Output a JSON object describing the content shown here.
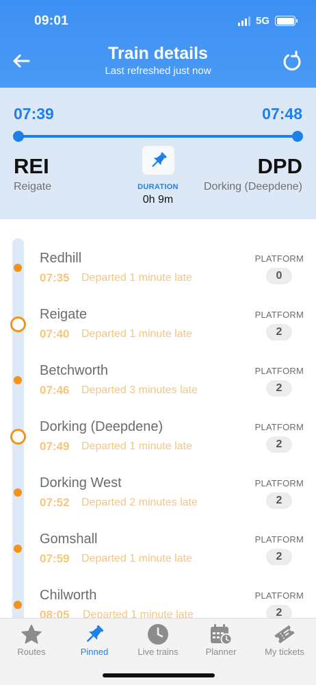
{
  "status_bar": {
    "time": "09:01",
    "network": "5G"
  },
  "header": {
    "title": "Train details",
    "subtitle": "Last refreshed just now",
    "back_icon": "arrow-left-icon",
    "refresh_icon": "refresh-icon"
  },
  "summary": {
    "departure_time": "07:39",
    "arrival_time": "07:48",
    "from_code": "REI",
    "from_name": "Reigate",
    "to_code": "DPD",
    "to_name": "Dorking (Deepdene)",
    "duration_label": "DURATION",
    "duration_value": "0h 9m",
    "pin_icon": "pin-icon"
  },
  "colors": {
    "accent": "#1e7fe6",
    "late": "#f39319",
    "late_text": "#f6c57e",
    "header_bg": "#3d8ff2",
    "summary_bg": "#dce8f6"
  },
  "stops": [
    {
      "name": "Redhill",
      "time": "07:35",
      "status": "Departed 1 minute late",
      "platform_label": "PLATFORM",
      "platform": "0",
      "highlight": false
    },
    {
      "name": "Reigate",
      "time": "07:40",
      "status": "Departed 1 minute late",
      "platform_label": "PLATFORM",
      "platform": "2",
      "highlight": true
    },
    {
      "name": "Betchworth",
      "time": "07:46",
      "status": "Departed 3 minutes late",
      "platform_label": "PLATFORM",
      "platform": "2",
      "highlight": false
    },
    {
      "name": "Dorking (Deepdene)",
      "time": "07:49",
      "status": "Departed 1 minute late",
      "platform_label": "PLATFORM",
      "platform": "2",
      "highlight": true
    },
    {
      "name": "Dorking West",
      "time": "07:52",
      "status": "Departed 2 minutes late",
      "platform_label": "PLATFORM",
      "platform": "2",
      "highlight": false
    },
    {
      "name": "Gomshall",
      "time": "07:59",
      "status": "Departed 1 minute late",
      "platform_label": "PLATFORM",
      "platform": "2",
      "highlight": false
    },
    {
      "name": "Chilworth",
      "time": "08:05",
      "status": "Departed 1 minute late",
      "platform_label": "PLATFORM",
      "platform": "2",
      "highlight": false
    }
  ],
  "tabs": [
    {
      "label": "Routes",
      "icon": "star-icon",
      "active": false
    },
    {
      "label": "Pinned",
      "icon": "pin-icon",
      "active": true
    },
    {
      "label": "Live trains",
      "icon": "clock-icon",
      "active": false
    },
    {
      "label": "Planner",
      "icon": "calendar-icon",
      "active": false
    },
    {
      "label": "My tickets",
      "icon": "ticket-icon",
      "active": false
    }
  ]
}
